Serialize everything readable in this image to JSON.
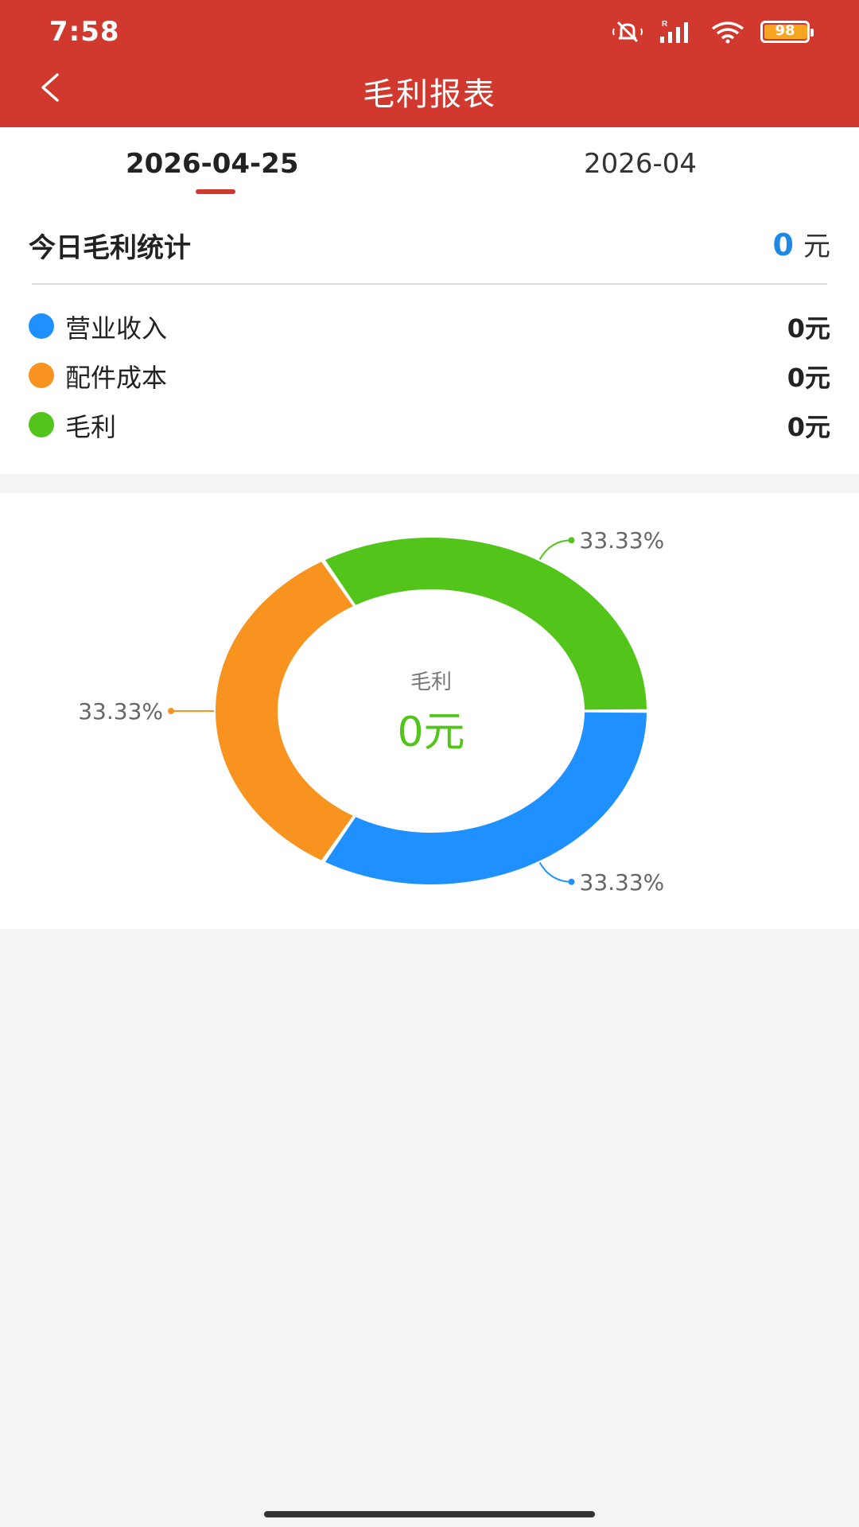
{
  "status_bar": {
    "time": "7:58",
    "battery_level": "98",
    "icons": [
      "mute-icon",
      "signal-icon",
      "wifi-icon",
      "battery-icon"
    ]
  },
  "header": {
    "title": "毛利报表",
    "back_icon": "chevron-left-icon",
    "background_color": "#d1382e"
  },
  "tabs": [
    {
      "label": "2026-04-25",
      "active": true
    },
    {
      "label": "2026-04",
      "active": false
    }
  ],
  "daily_stats": {
    "title": "今日毛利统计",
    "total_value": "0",
    "total_unit": "元",
    "items": [
      {
        "label": "营业收入",
        "value": "0元",
        "color": "#1e90ff"
      },
      {
        "label": "配件成本",
        "value": "0元",
        "color": "#f7931e"
      },
      {
        "label": "毛利",
        "value": "0元",
        "color": "#52c41a"
      }
    ]
  },
  "chart_data": {
    "type": "pie",
    "style": "donut",
    "center_label": "毛利",
    "center_value": "0元",
    "slices": [
      {
        "name": "营业收入",
        "value": 33.33,
        "label": "33.33%",
        "color": "#1e90ff"
      },
      {
        "name": "配件成本",
        "value": 33.33,
        "label": "33.33%",
        "color": "#f7931e"
      },
      {
        "name": "毛利",
        "value": 33.33,
        "label": "33.33%",
        "color": "#52c41a"
      }
    ],
    "start_angle_deg": 0,
    "direction": "clockwise",
    "legend": "none"
  }
}
